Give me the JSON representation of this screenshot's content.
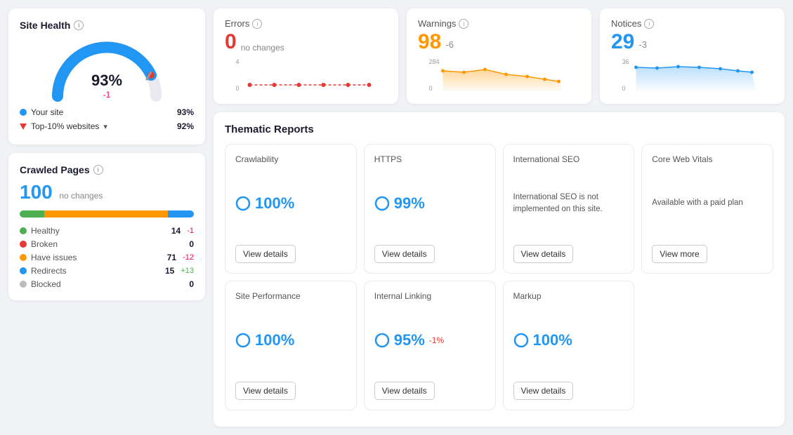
{
  "siteHealth": {
    "title": "Site Health",
    "percent": "93%",
    "change": "-1",
    "legend": [
      {
        "type": "dot-blue",
        "label": "Your site",
        "value": "93%"
      },
      {
        "type": "triangle-red",
        "label": "Top-10% websites",
        "dropdown": true,
        "value": "92%"
      }
    ]
  },
  "crawledPages": {
    "title": "Crawled Pages",
    "value": "100",
    "sub": "no changes",
    "stats": [
      {
        "dot": "dot-green",
        "label": "Healthy",
        "value": "14",
        "change": "-1",
        "changeType": "neg"
      },
      {
        "dot": "dot-red",
        "label": "Broken",
        "value": "0",
        "change": "",
        "changeType": ""
      },
      {
        "dot": "dot-orange",
        "label": "Have issues",
        "value": "71",
        "change": "-12",
        "changeType": "neg"
      },
      {
        "dot": "dot-blue",
        "label": "Redirects",
        "value": "15",
        "change": "+13",
        "changeType": "pos"
      },
      {
        "dot": "dot-gray",
        "label": "Blocked",
        "value": "0",
        "change": "",
        "changeType": ""
      }
    ]
  },
  "metrics": [
    {
      "title": "Errors",
      "value": "0",
      "colorClass": "red",
      "sub": "no changes",
      "chartType": "flat-red",
      "yMax": "4",
      "yMin": "0"
    },
    {
      "title": "Warnings",
      "value": "98",
      "colorClass": "orange",
      "change": "-6",
      "sub": "",
      "chartType": "area-orange",
      "yMax": "284",
      "yMin": "0"
    },
    {
      "title": "Notices",
      "value": "29",
      "colorClass": "blue",
      "change": "-3",
      "sub": "",
      "chartType": "area-blue",
      "yMax": "36",
      "yMin": "0"
    }
  ],
  "thematic": {
    "title": "Thematic Reports",
    "reports": [
      {
        "name": "Crawlability",
        "value": "100%",
        "change": "",
        "hasCircle": true,
        "btnLabel": "View details",
        "desc": ""
      },
      {
        "name": "HTTPS",
        "value": "99%",
        "change": "",
        "hasCircle": true,
        "btnLabel": "View details",
        "desc": ""
      },
      {
        "name": "International SEO",
        "value": "",
        "change": "",
        "hasCircle": false,
        "btnLabel": "View details",
        "desc": "International SEO is not implemented on this site."
      },
      {
        "name": "Core Web Vitals",
        "value": "",
        "change": "",
        "hasCircle": false,
        "btnLabel": "View more",
        "desc": "Available with a paid plan"
      },
      {
        "name": "Site Performance",
        "value": "100%",
        "change": "",
        "hasCircle": true,
        "btnLabel": "View details",
        "desc": ""
      },
      {
        "name": "Internal Linking",
        "value": "95%",
        "change": "-1%",
        "hasCircle": true,
        "btnLabel": "View details",
        "desc": ""
      },
      {
        "name": "Markup",
        "value": "100%",
        "change": "",
        "hasCircle": true,
        "btnLabel": "View details",
        "desc": ""
      }
    ]
  }
}
